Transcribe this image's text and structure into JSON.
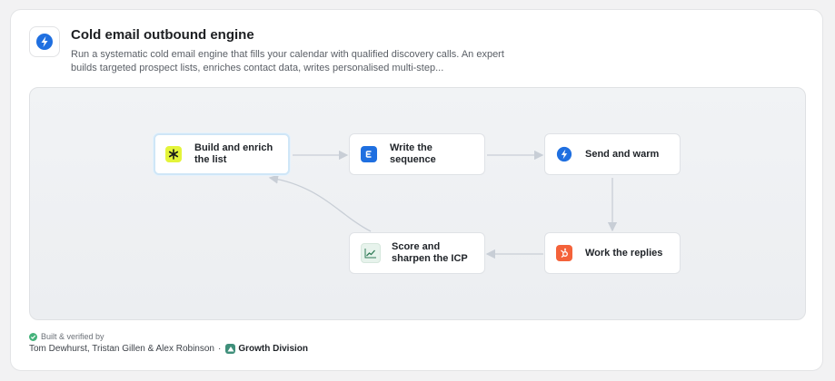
{
  "header": {
    "title": "Cold email outbound engine",
    "description": "Run a systematic cold email engine that fills your calendar with qualified discovery calls. An expert builds targeted prospect lists, enriches contact data, writes personalised multi-step...",
    "icon": "lightning-bolt-icon"
  },
  "workflow": {
    "nodes": [
      {
        "label": "Build and enrich the list",
        "icon": "asterisk-icon",
        "icon_color": "#e4f43a",
        "active": true
      },
      {
        "label": "Write the sequence",
        "icon": "document-e-icon",
        "icon_color": "#1f6fe0",
        "active": false
      },
      {
        "label": "Send and warm",
        "icon": "lightning-bolt-icon",
        "icon_color": "#1f6fe0",
        "active": false
      },
      {
        "label": "Work the replies",
        "icon": "hubspot-icon",
        "icon_color": "#f4623a",
        "active": false
      },
      {
        "label": "Score and sharpen the ICP",
        "icon": "trend-chart-icon",
        "icon_color": "#3a9a6e",
        "active": false
      }
    ]
  },
  "footer": {
    "verified_label": "Built & verified by",
    "authors": "Tom Dewhurst, Tristan Gillen & Alex Robinson",
    "separator": "·",
    "org_name": "Growth Division"
  },
  "colors": {
    "accent": "#1f6fe0",
    "edge": "#c8ced6",
    "active_border": "#cfe6f7"
  }
}
